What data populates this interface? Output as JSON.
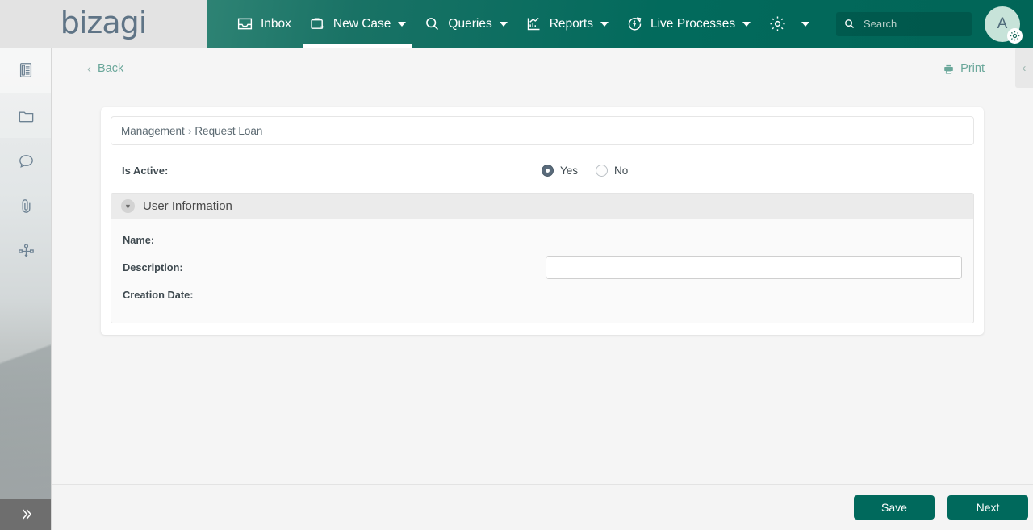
{
  "brand": {
    "name": "bizagi"
  },
  "nav": {
    "items": [
      {
        "label": "Inbox",
        "icon": "inbox-icon",
        "caret": false,
        "active": false
      },
      {
        "label": "New Case",
        "icon": "new-case-icon",
        "caret": true,
        "active": true
      },
      {
        "label": "Queries",
        "icon": "search-icon",
        "caret": true,
        "active": false
      },
      {
        "label": "Reports",
        "icon": "reports-chart-icon",
        "caret": true,
        "active": false
      },
      {
        "label": "Live Processes",
        "icon": "live-processes-icon",
        "caret": true,
        "active": false
      },
      {
        "label": "",
        "icon": "gear-icon",
        "caret": true,
        "active": false
      }
    ],
    "search": {
      "placeholder": "Search",
      "value": ""
    },
    "avatar": {
      "initial": "A",
      "badge_icon": "gear-icon"
    }
  },
  "sidebar": {
    "items": [
      {
        "name": "sidebar-item-form",
        "icon": "form-list-icon"
      },
      {
        "name": "sidebar-item-documents",
        "icon": "folder-icon"
      },
      {
        "name": "sidebar-item-comments",
        "icon": "comment-icon"
      },
      {
        "name": "sidebar-item-attachments",
        "icon": "paperclip-icon"
      },
      {
        "name": "sidebar-item-process",
        "icon": "process-diagram-icon"
      }
    ],
    "expand_icon": "double-chevron-right-icon"
  },
  "page_header": {
    "back_label": "Back",
    "back_icon": "chevron-left-icon",
    "print_label": "Print",
    "print_icon": "printer-icon",
    "rail_collapse_icon": "chevron-left-icon"
  },
  "breadcrumb": {
    "parent": "Management",
    "separator": "›",
    "current": "Request Loan"
  },
  "form": {
    "is_active": {
      "label": "Is Active:",
      "options": [
        {
          "label": "Yes",
          "selected": true
        },
        {
          "label": "No",
          "selected": false
        }
      ]
    },
    "panel": {
      "title": "User Information",
      "collapse_icon": "chevron-down-icon",
      "fields": [
        {
          "label": "Name:",
          "type": "text",
          "value": "",
          "has_input": false
        },
        {
          "label": "Description:",
          "type": "input",
          "value": "",
          "has_input": true
        },
        {
          "label": "Creation Date:",
          "type": "text",
          "value": "",
          "has_input": false
        }
      ]
    }
  },
  "footer": {
    "save_label": "Save",
    "next_label": "Next"
  },
  "colors": {
    "header_teal": "#026a5c",
    "button_teal": "#00695c",
    "link_green": "#6aa79a",
    "radio_selected": "#5a6b7b",
    "brand_gray": "#5f7486",
    "avatar_bg": "#c7e3d9"
  }
}
